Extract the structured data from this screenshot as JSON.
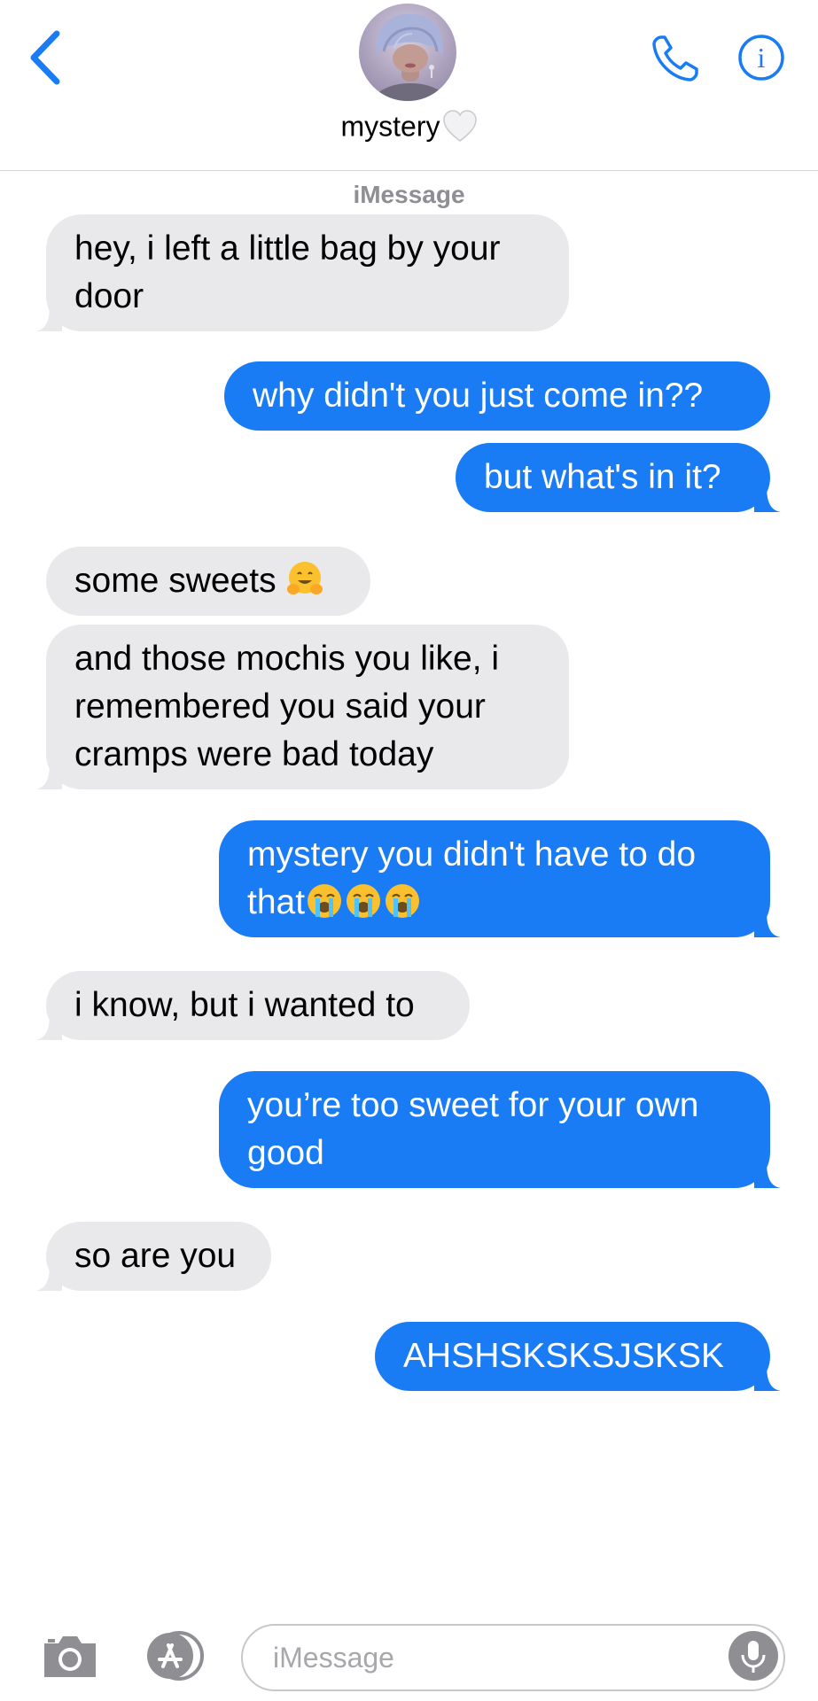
{
  "header": {
    "contact_name": "mystery",
    "name_emoji": "white-heart",
    "avatar": "avatar-photo",
    "icons": {
      "back": "chevron-left-icon",
      "call": "phone-icon",
      "info": "info-icon"
    }
  },
  "thread": {
    "service_label": "iMessage",
    "messages": [
      {
        "direction": "incoming",
        "text": "hey, i left a little bag by your door"
      },
      {
        "direction": "outgoing",
        "text": "why didn't you just come in??"
      },
      {
        "direction": "outgoing",
        "text": "but what's in it?"
      },
      {
        "direction": "incoming",
        "text": "some sweets ",
        "emoji": [
          "hugging-face"
        ]
      },
      {
        "direction": "incoming",
        "text": "and those mochis you like, i remembered you said your cramps were bad today"
      },
      {
        "direction": "outgoing",
        "text": "mystery you didn't have to do that",
        "emoji": [
          "loudly-crying-face",
          "loudly-crying-face",
          "loudly-crying-face"
        ]
      },
      {
        "direction": "incoming",
        "text": "i know, but i wanted to"
      },
      {
        "direction": "outgoing",
        "text": "you’re too sweet for your own good"
      },
      {
        "direction": "incoming",
        "text": "so are you"
      },
      {
        "direction": "outgoing",
        "text": "AHSHSKSKSJSKSK"
      }
    ]
  },
  "composer": {
    "placeholder": "iMessage",
    "value": "",
    "icons": {
      "camera": "camera-icon",
      "apps": "app-store-icon",
      "mic": "microphone-icon"
    }
  },
  "colors": {
    "accent": "#1a7cf5",
    "outgoing_bubble": "#1a7cf5",
    "incoming_bubble": "#e9e9eb",
    "secondary_text": "#8e8e93"
  }
}
